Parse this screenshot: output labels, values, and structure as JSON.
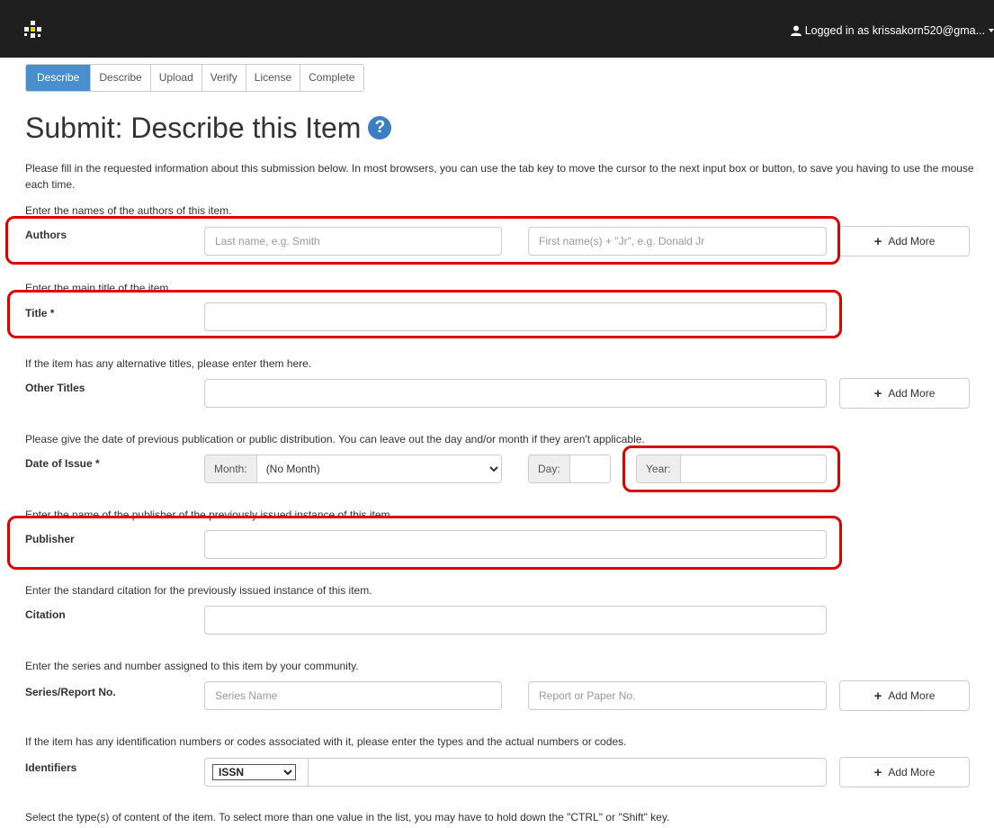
{
  "header": {
    "logo_icon": "dspace-logo-icon",
    "user_icon": "user-icon",
    "user_text": "Logged in as krissakorn520@gma..."
  },
  "steps": [
    {
      "label": "Describe",
      "active": true
    },
    {
      "label": "Describe",
      "active": false
    },
    {
      "label": "Upload",
      "active": false
    },
    {
      "label": "Verify",
      "active": false
    },
    {
      "label": "License",
      "active": false
    },
    {
      "label": "Complete",
      "active": false
    }
  ],
  "page": {
    "title": "Submit: Describe this Item",
    "help_icon": "?",
    "intro": "Please fill in the requested information about this submission below. In most browsers, you can use the tab key to move the cursor to the next input box or button, to save you having to use the mouse each time."
  },
  "fields": {
    "authors": {
      "hint": "Enter the names of the authors of this item.",
      "label": "Authors",
      "last_placeholder": "Last name, e.g. Smith",
      "first_placeholder": "First name(s) + \"Jr\", e.g. Donald Jr"
    },
    "title": {
      "hint": "Enter the main title of the item.",
      "label": "Title *"
    },
    "other_titles": {
      "hint": "If the item has any alternative titles, please enter them here.",
      "label": "Other Titles"
    },
    "date_of_issue": {
      "hint": "Please give the date of previous publication or public distribution. You can leave out the day and/or month if they aren't applicable.",
      "label": "Date of Issue *",
      "month_label": "Month:",
      "month_value": "(No Month)",
      "day_label": "Day:",
      "year_label": "Year:"
    },
    "publisher": {
      "hint": "Enter the name of the publisher of the previously issued instance of this item.",
      "label": "Publisher"
    },
    "citation": {
      "hint": "Enter the standard citation for the previously issued instance of this item.",
      "label": "Citation"
    },
    "series": {
      "hint": "Enter the series and number assigned to this item by your community.",
      "label": "Series/Report No.",
      "series_placeholder": "Series Name",
      "report_placeholder": "Report or Paper No."
    },
    "identifiers": {
      "hint": "If the item has any identification numbers or codes associated with it, please enter the types and the actual numbers or codes.",
      "label": "Identifiers",
      "type_value": "ISSN"
    },
    "types": {
      "hint": "Select the type(s) of content of the item. To select more than one value in the list, you may have to hold down the \"CTRL\" or \"Shift\" key."
    }
  },
  "buttons": {
    "add_more": "Add More",
    "plus_icon": "+"
  },
  "colors": {
    "navbar": "#1f1f1f",
    "active_step": "#4a8fcd",
    "help_icon": "#3a7fc4",
    "highlight": "#e00000"
  }
}
